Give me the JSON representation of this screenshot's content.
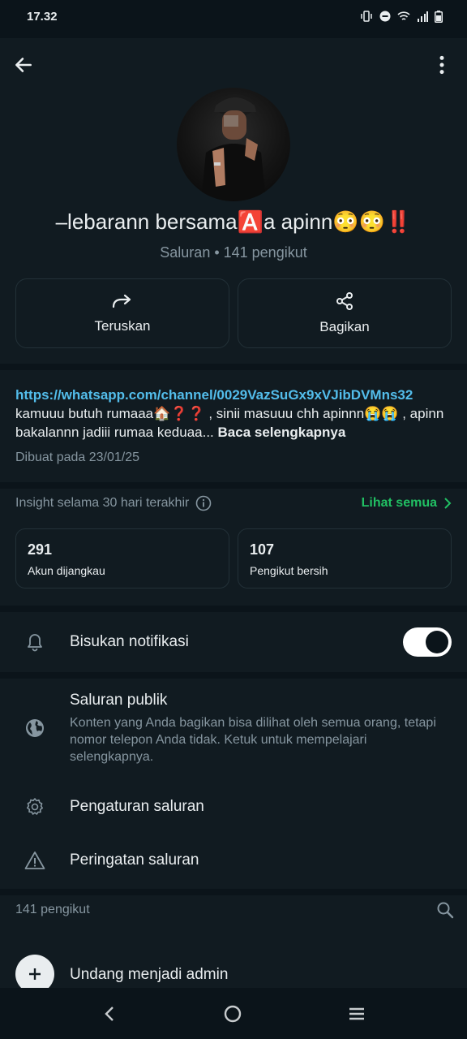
{
  "status": {
    "time": "17.32"
  },
  "channel": {
    "name": "–lebarann bersama🅰️a apinn😳😳‼️",
    "meta": "Saluran • 141 pengikut"
  },
  "actions": {
    "forward_label": "Teruskan",
    "share_label": "Bagikan"
  },
  "description": {
    "link": "https://whatsapp.com/channel/0029VazSuGx9xVJibDVMns32",
    "text": "kamuuu butuh rumaaa🏠❓❓ , sinii masuuu chh apinnn😭😭 , apinn bakalannn jadiii rumaa keduaa...",
    "more_label": "Baca selengkapnya",
    "created": "Dibuat pada 23/01/25"
  },
  "insights": {
    "title": "Insight selama 30 hari terakhir",
    "see_all": "Lihat semua",
    "stats": [
      {
        "value": "291",
        "label": "Akun dijangkau"
      },
      {
        "value": "107",
        "label": "Pengikut bersih"
      }
    ]
  },
  "settings": {
    "mute_label": "Bisukan notifikasi",
    "mute_enabled": true,
    "public_title": "Saluran publik",
    "public_desc": "Konten yang Anda bagikan bisa dilihat oleh semua orang, tetapi nomor telepon Anda tidak. Ketuk untuk mempelajari selengkapnya.",
    "channel_settings": "Pengaturan saluran",
    "channel_warning": "Peringatan saluran"
  },
  "followers": {
    "count_label": "141 pengikut",
    "invite_label": "Undang menjadi admin"
  },
  "colors": {
    "accent_green": "#21c063",
    "link_blue": "#53bdeb",
    "background": "#111b21"
  }
}
